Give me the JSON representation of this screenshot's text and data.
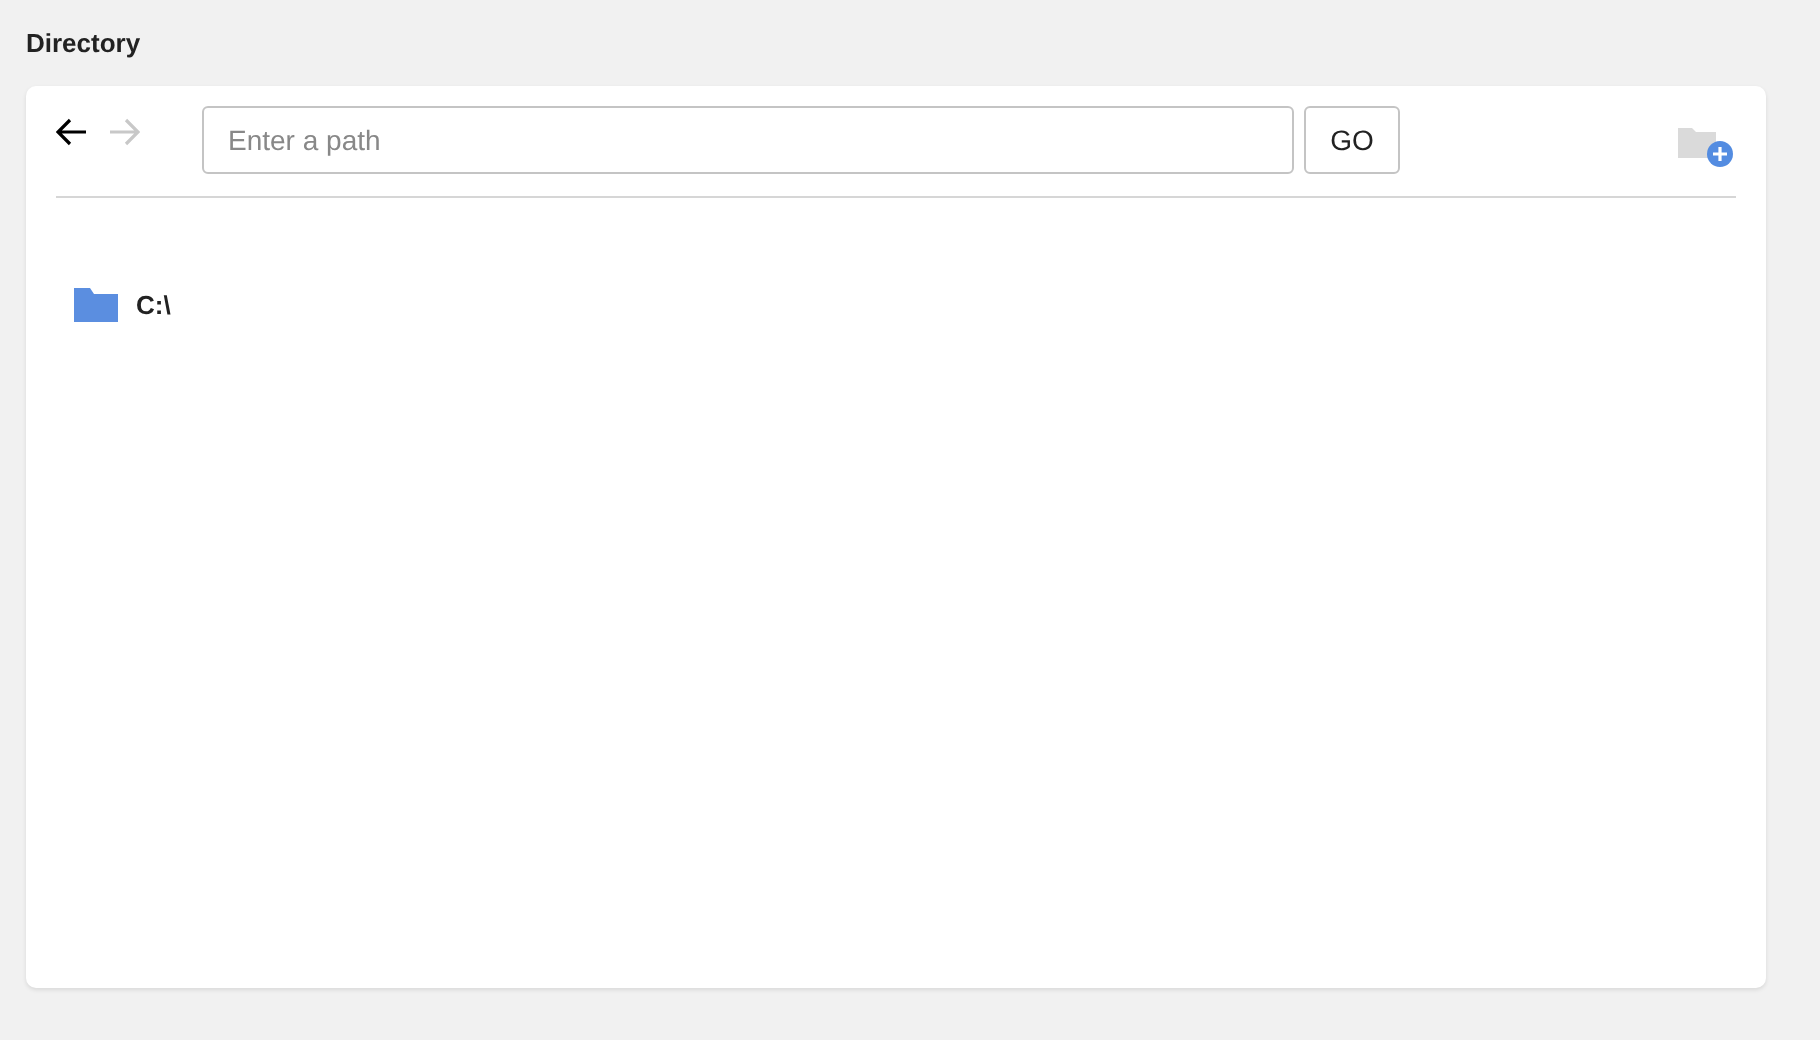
{
  "section_title": "Directory",
  "nav": {
    "back": {
      "disabled": false
    },
    "forward": {
      "disabled": true
    }
  },
  "path_field": {
    "placeholder": "Enter a path"
  },
  "go_button": "GO",
  "new_folder": {
    "disabled": true
  },
  "entries": [
    {
      "name": "C:\\"
    }
  ]
}
